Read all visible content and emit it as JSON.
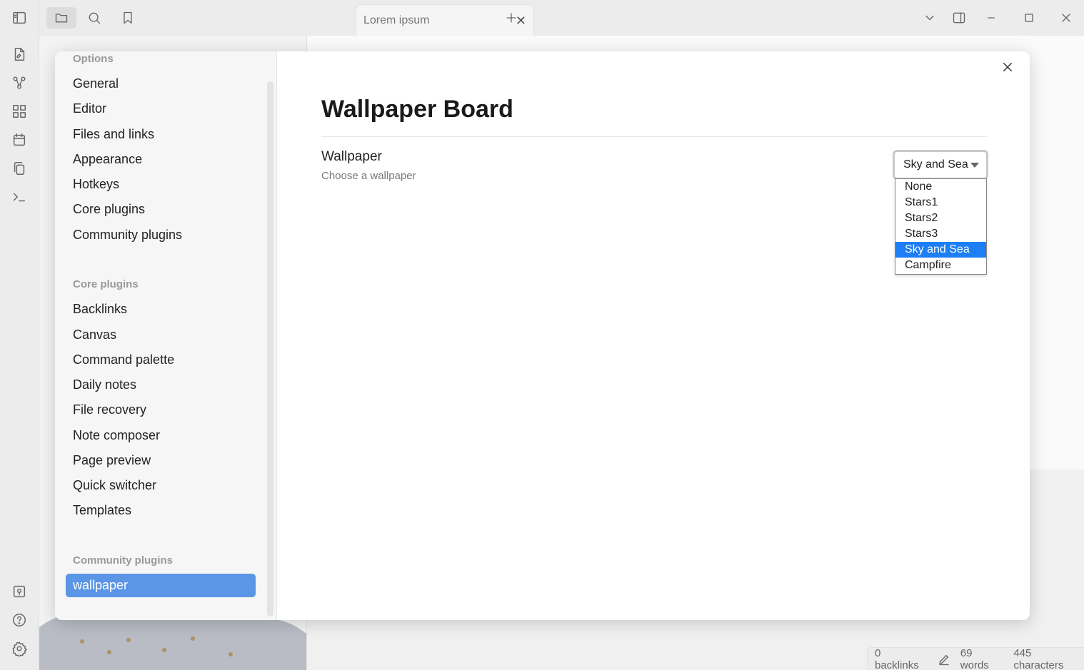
{
  "tab": {
    "title": "Lorem ipsum"
  },
  "status": {
    "backlinks": "0 backlinks",
    "words": "69 words",
    "characters": "445 characters"
  },
  "settings": {
    "sections": [
      {
        "heading": "Options",
        "items": [
          "General",
          "Editor",
          "Files and links",
          "Appearance",
          "Hotkeys",
          "Core plugins",
          "Community plugins"
        ]
      },
      {
        "heading": "Core plugins",
        "items": [
          "Backlinks",
          "Canvas",
          "Command palette",
          "Daily notes",
          "File recovery",
          "Note composer",
          "Page preview",
          "Quick switcher",
          "Templates"
        ]
      },
      {
        "heading": "Community plugins",
        "items": [
          "wallpaper"
        ]
      }
    ],
    "active_item": "wallpaper",
    "page_title": "Wallpaper Board",
    "setting": {
      "name": "Wallpaper",
      "description": "Choose a wallpaper",
      "selected": "Sky and Sea",
      "options": [
        "None",
        "Stars1",
        "Stars2",
        "Stars3",
        "Sky and Sea",
        "Campfire"
      ]
    }
  },
  "colors": {
    "accent": "#5b95e6",
    "dropdown_highlight": "#1e7ff5"
  }
}
